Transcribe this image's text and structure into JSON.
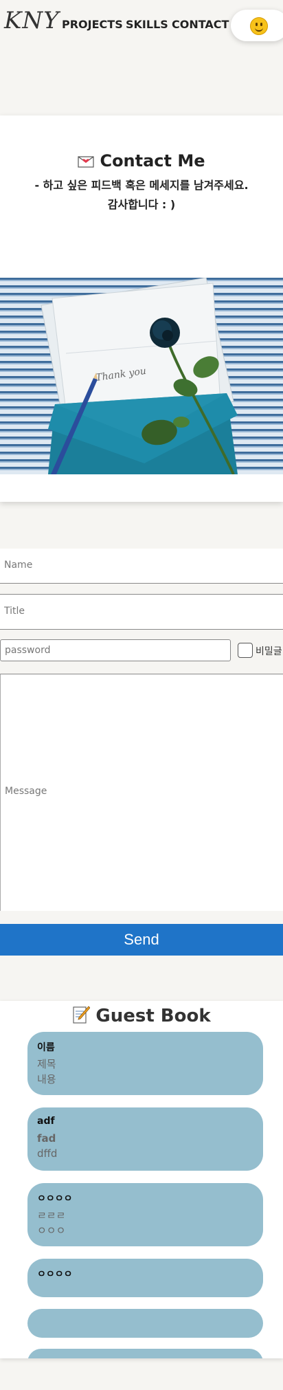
{
  "nav": {
    "logo": "KNY",
    "links": [
      "PROJECTS",
      "SKILLS",
      "CONTACT"
    ],
    "theme_icon": "smiley-icon"
  },
  "contact": {
    "title": "Contact Me",
    "subtitle_line1": "- 하고 싶은 피드백 혹은 메세지를 남겨주세요.",
    "subtitle_line2": "감사합니다 : )",
    "photo_text": "Thank you"
  },
  "form": {
    "name_placeholder": "Name",
    "title_placeholder": "Title",
    "password_placeholder": "password",
    "password_checkbox_label": "비밀글",
    "message_placeholder": "Message",
    "send_label": "Send"
  },
  "guestbook": {
    "title": "Guest Book",
    "entries": [
      {
        "name": "이름",
        "title": "제목",
        "content": "내용"
      },
      {
        "name": "adf",
        "title": "fad",
        "content": "dffd"
      },
      {
        "name": "ㅇㅇㅇㅇ",
        "title": "ㄹㄹㄹ",
        "content": "ㅇㅇㅇ"
      },
      {
        "name": "ㅇㅇㅇㅇ",
        "title": "",
        "content": ""
      },
      {
        "name": "",
        "title": "",
        "content": ""
      },
      {
        "name": "",
        "title": "",
        "content": ""
      }
    ]
  },
  "colors": {
    "send_button": "#1f74c8",
    "guestbook_entry": "#95bece",
    "page_bg": "#f6f5f2"
  }
}
